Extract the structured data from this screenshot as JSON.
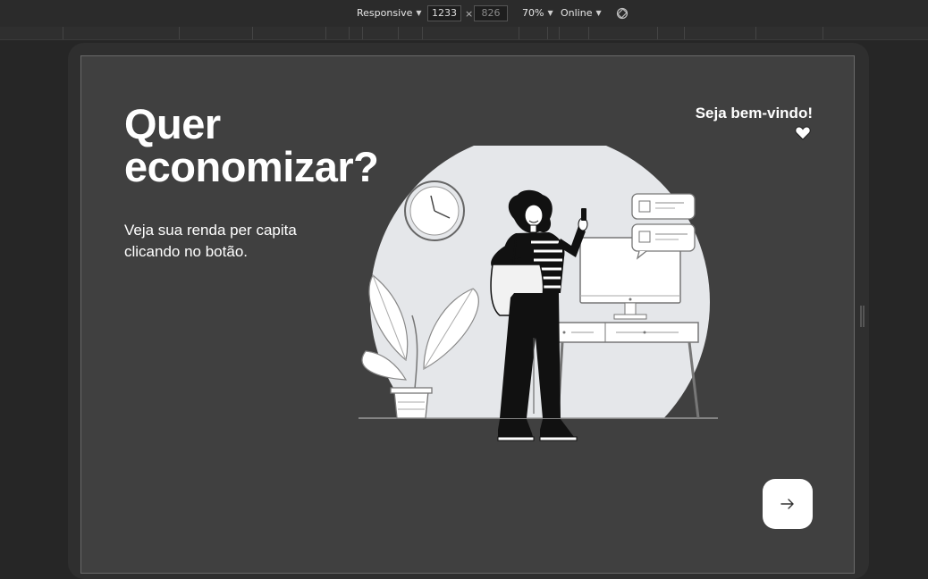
{
  "devtools": {
    "device_mode": "Responsive",
    "width": "1233",
    "times": "×",
    "height": "826",
    "zoom": "70%",
    "throttling": "Online",
    "rotate_icon": "rotate-icon"
  },
  "hero": {
    "headline_line1": "Quer",
    "headline_line2": "economizar?",
    "subtitle_line1": "Veja sua renda per capita",
    "subtitle_line2": "clicando no botão.",
    "welcome": "Seja bem-vindo!",
    "heart_icon": "heart-icon",
    "next_icon": "arrow-right-icon"
  },
  "colors": {
    "page_background": "#404040",
    "text": "#ffffff",
    "illustration_circle": "#e5e7ea",
    "button_background": "#ffffff"
  }
}
